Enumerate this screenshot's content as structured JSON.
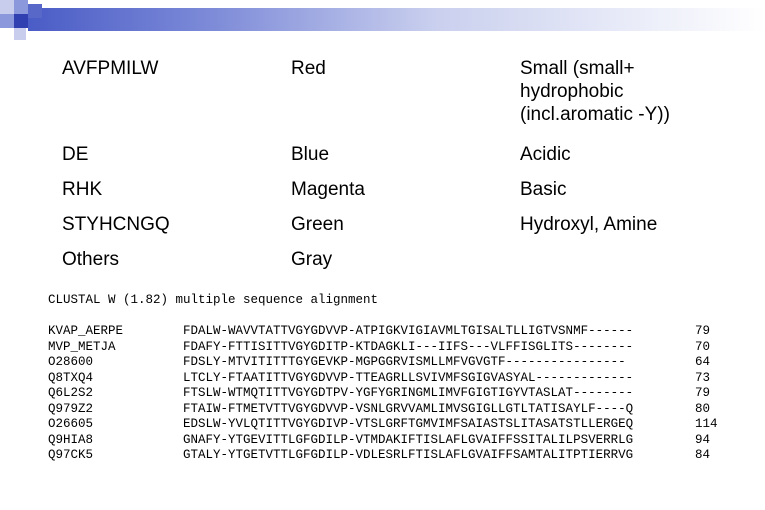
{
  "legend": {
    "rows": [
      {
        "residues": "AVFPMILW",
        "color": "Red",
        "property": "Small (small+ hydrophobic (incl.aromatic -Y))"
      },
      {
        "residues": "DE",
        "color": "Blue",
        "property": "Acidic"
      },
      {
        "residues": "RHK",
        "color": "Magenta",
        "property": "Basic"
      },
      {
        "residues": "STYHCNGQ",
        "color": "Green",
        "property": "Hydroxyl, Amine"
      },
      {
        "residues": "Others",
        "color": "Gray",
        "property": ""
      }
    ]
  },
  "alignment": {
    "header": "CLUSTAL W (1.82) multiple sequence alignment",
    "sequences": [
      {
        "name": "KVAP_AERPE",
        "seq": "FDALW-WAVVTATTVGYGDVVP-ATPIGKVIGIAVMLTGISALTLLIGTVSNMF------",
        "pos": "79"
      },
      {
        "name": "MVP_METJA",
        "seq": "FDAFY-FTTISITTVGYGDITP-KTDAGKLI---IIFS---VLFFISGLITS--------",
        "pos": "70"
      },
      {
        "name": "O28600",
        "seq": "FDSLY-MTVITITTTGYGEVKP-MGPGGRVISMLLMFVGVGTF----------------",
        "pos": "64"
      },
      {
        "name": "Q8TXQ4",
        "seq": "LTCLY-FTAATITTVGYGDVVP-TTEAGRLLSVIVMFSGIGVASYAL-------------",
        "pos": "73"
      },
      {
        "name": "Q6L2S2",
        "seq": "FTSLW-WTMQTITTVGYGDTPV-YGFYGRINGMLIMVFGIGTIGYVTASLAT--------",
        "pos": "79"
      },
      {
        "name": "Q979Z2",
        "seq": "FTAIW-FTMETVTTVGYGDVVP-VSNLGRVVAMLIMVSGIGLLGTLTATISAYLF----Q",
        "pos": "80"
      },
      {
        "name": "O26605",
        "seq": "EDSLW-YVLQTITTVGYGDIVP-VTSLGRFTGMVIMFSAIASTSLITASATSTLLERGEQ",
        "pos": "114"
      },
      {
        "name": "Q9HIA8",
        "seq": "GNAFY-YTGEVITTLGFGDILP-VTMDAKIFTISLAFLGVAIFFSSITALILPSVERRLG",
        "pos": "94"
      },
      {
        "name": "Q97CK5",
        "seq": "GTALY-YTGETVTTLGFGDILP-VDLESRLFTISLAFLGVAIFFSAMTALITPTIERRVG",
        "pos": "84"
      }
    ]
  },
  "colors": {
    "Red": "#cc0000",
    "Blue": "#0000cc",
    "Magenta": "#cc00cc",
    "Green": "#009900",
    "Gray": "#666666",
    "deco_dark": "#3040b0",
    "deco_light": "#a8b2e6"
  }
}
